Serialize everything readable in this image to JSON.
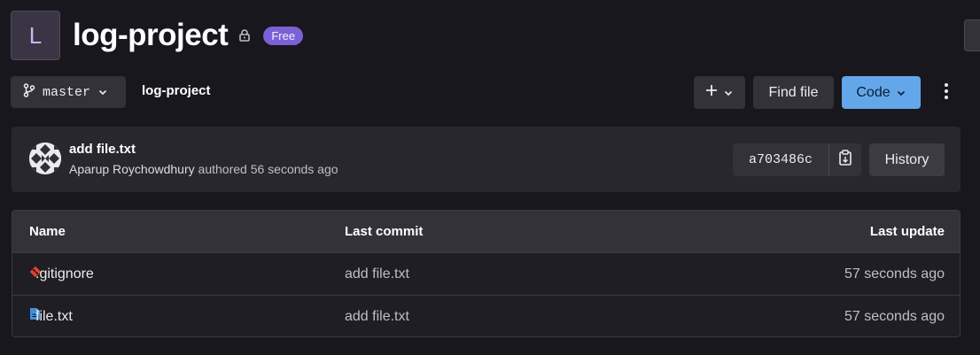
{
  "header": {
    "avatar_letter": "L",
    "project_name": "log-project",
    "plan_badge": "Free"
  },
  "toolbar": {
    "branch": "master",
    "breadcrumb": "log-project",
    "add_label": "+",
    "find_file_label": "Find file",
    "code_label": "Code"
  },
  "last_commit": {
    "message": "add file.txt",
    "author": "Aparup Roychowdhury",
    "authored_text": "authored 56 seconds ago",
    "sha": "a703486c",
    "history_label": "History"
  },
  "file_table": {
    "columns": [
      "Name",
      "Last commit",
      "Last update"
    ],
    "rows": [
      {
        "icon": "git-icon",
        "name": ".gitignore",
        "last_commit": "add file.txt",
        "last_update": "57 seconds ago"
      },
      {
        "icon": "file-icon",
        "name": "file.txt",
        "last_commit": "add file.txt",
        "last_update": "57 seconds ago"
      }
    ]
  },
  "colors": {
    "background": "#18171d",
    "badge": "#7b61d6",
    "primary_button": "#63a6e9",
    "git_icon": "#e24329",
    "file_icon": "#428fdc"
  }
}
